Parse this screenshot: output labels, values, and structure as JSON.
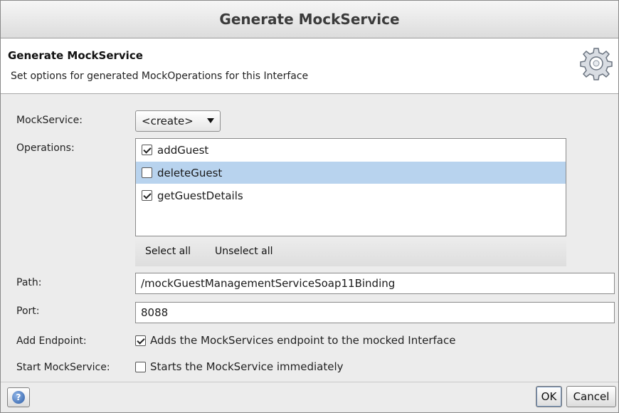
{
  "window": {
    "title": "Generate MockService"
  },
  "header": {
    "title": "Generate MockService",
    "description": "Set options for generated MockOperations for this Interface",
    "icon": "gear-icon"
  },
  "form": {
    "mockservice_label": "MockService:",
    "mockservice_value": "<create>",
    "operations_label": "Operations:",
    "operations": [
      {
        "label": "addGuest",
        "checked": true,
        "selected": false
      },
      {
        "label": "deleteGuest",
        "checked": false,
        "selected": true
      },
      {
        "label": "getGuestDetails",
        "checked": true,
        "selected": false
      }
    ],
    "select_all_label": "Select all",
    "unselect_all_label": "Unselect all",
    "path_label": "Path:",
    "path_value": "/mockGuestManagementServiceSoap11Binding",
    "port_label": "Port:",
    "port_value": "8088",
    "add_endpoint_label": "Add Endpoint:",
    "add_endpoint_text": "Adds the MockServices endpoint to the mocked Interface",
    "add_endpoint_checked": true,
    "start_label": "Start MockService:",
    "start_text": "Starts the MockService immediately",
    "start_checked": false
  },
  "footer": {
    "help_icon": "help-icon",
    "ok_label": "OK",
    "cancel_label": "Cancel"
  }
}
